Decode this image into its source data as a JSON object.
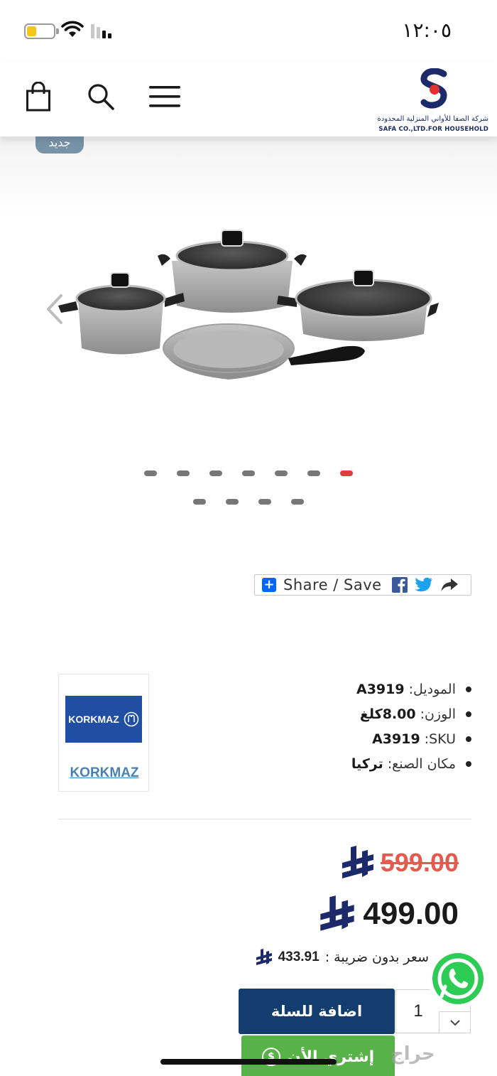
{
  "status_bar": {
    "time": "١٢:٠٥",
    "battery_level": 0.35,
    "battery_color": "#f5c518"
  },
  "header": {
    "logo": {
      "arabic_name": "شركة الصفا للأواني المنزلية المحدودة",
      "english_name": "SAFA CO.,LTD.FOR HOUSEHOLD"
    },
    "icons": [
      "cart-icon",
      "search-icon",
      "menu-icon"
    ]
  },
  "gallery": {
    "badge": "جديد",
    "total_images": 11,
    "active_index": 6,
    "dot_rows": [
      [
        "dot",
        "dot",
        "dot",
        "dot",
        "dot",
        "dot",
        "active"
      ],
      [
        "dot",
        "dot",
        "dot",
        "dot"
      ]
    ],
    "accent_color": "#e23d3d"
  },
  "share": {
    "label": "Share / Save",
    "icons": [
      "plus-icon",
      "facebook-icon",
      "twitter-icon",
      "share-arrow-icon"
    ]
  },
  "brand": {
    "logo_text": "KORKMAZ",
    "link_text": "KORKMAZ"
  },
  "specs": [
    {
      "label": "الموديل:",
      "value": "A3919"
    },
    {
      "label": "الوزن:",
      "value": "8.00كلغ"
    },
    {
      "label": "SKU:",
      "value": "A3919"
    },
    {
      "label": "مكان الصنع:",
      "value": "تركيا"
    }
  ],
  "price": {
    "old": "599.00",
    "current": "499.00",
    "tax_label": "سعر بدون ضريبة :",
    "tax_value": "433.91",
    "currency_icon": "riyal-icon"
  },
  "cart": {
    "add_to_cart": "اضافة للسلة",
    "quantity": "1",
    "buy_now": "إشتري الأن",
    "primary_color": "#123d6e",
    "buy_color": "#57b347"
  },
  "watermark": "حراج"
}
